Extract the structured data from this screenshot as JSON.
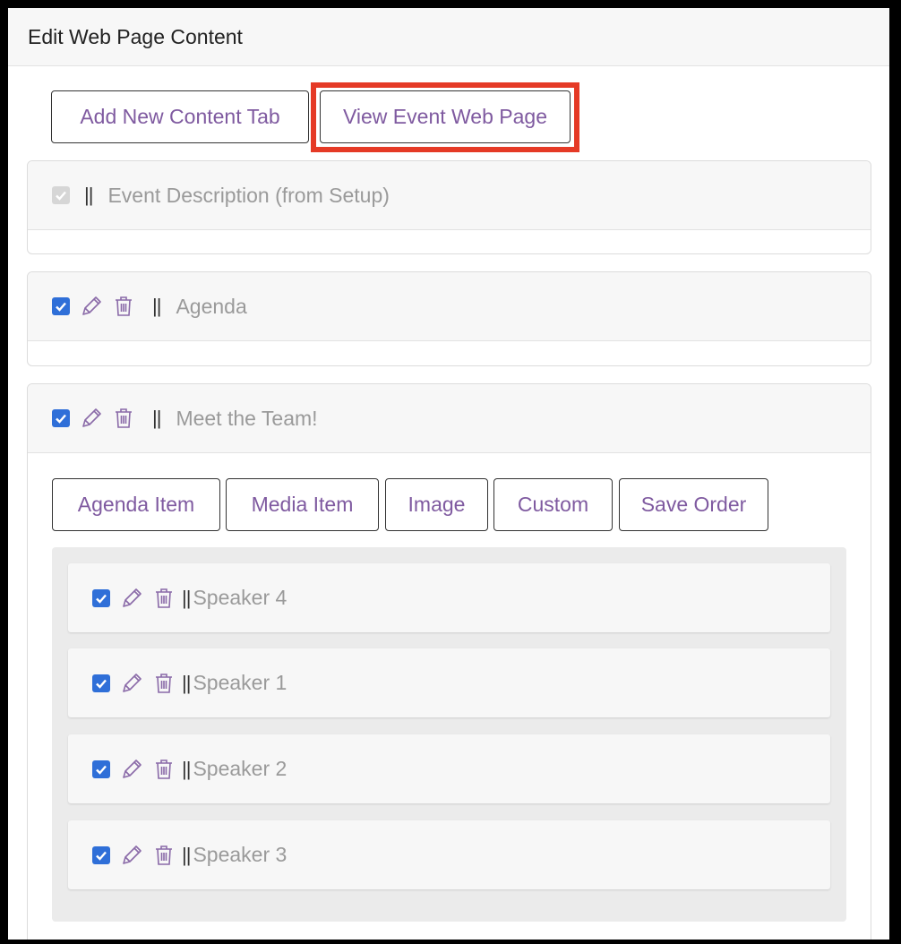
{
  "header": {
    "title": "Edit Web Page Content"
  },
  "toolbar": {
    "add_tab_label": "Add New Content Tab",
    "view_page_label": "View Event Web Page"
  },
  "grip_symbol": "||",
  "tabs": [
    {
      "label": "Event Description (from Setup)",
      "checked": true,
      "disabled": true
    },
    {
      "label": "Agenda",
      "checked": true,
      "disabled": false
    },
    {
      "label": "Meet the Team!",
      "checked": true,
      "disabled": false
    }
  ],
  "item_buttons": [
    "Agenda Item",
    "Media Item",
    "Image",
    "Custom",
    "Save Order"
  ],
  "items": [
    {
      "label": "Speaker 4",
      "checked": true
    },
    {
      "label": "Speaker 1",
      "checked": true
    },
    {
      "label": "Speaker 2",
      "checked": true
    },
    {
      "label": "Speaker 3",
      "checked": true
    }
  ],
  "colors": {
    "accent_purple": "#7f5aa0",
    "checkbox_blue": "#2f6fd8",
    "highlight_red": "#e53a26"
  }
}
